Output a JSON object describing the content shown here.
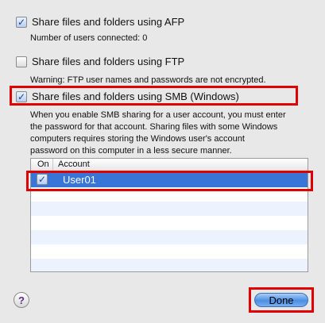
{
  "afp": {
    "label": "Share files and folders using AFP",
    "checked": true,
    "note": "Number of users connected: 0"
  },
  "ftp": {
    "label": "Share files and folders using FTP",
    "checked": false,
    "note": "Warning: FTP user names and passwords are not encrypted."
  },
  "smb": {
    "label": "Share files and folders using SMB (Windows)",
    "checked": true,
    "description": [
      "When you enable SMB sharing for a user account, you must enter",
      "the password for that account. Sharing files with some Windows",
      "computers requires storing the Windows user's account",
      "password on this computer in a less secure manner."
    ]
  },
  "accounts_table": {
    "headers": {
      "on": "On",
      "account": "Account"
    },
    "rows": [
      {
        "on": true,
        "account": "User01",
        "selected": true
      }
    ]
  },
  "buttons": {
    "help": "?",
    "done": "Done"
  },
  "colors": {
    "highlight_border": "#e00000",
    "selection": "#3875d7",
    "alt_row": "#edf3fe"
  }
}
